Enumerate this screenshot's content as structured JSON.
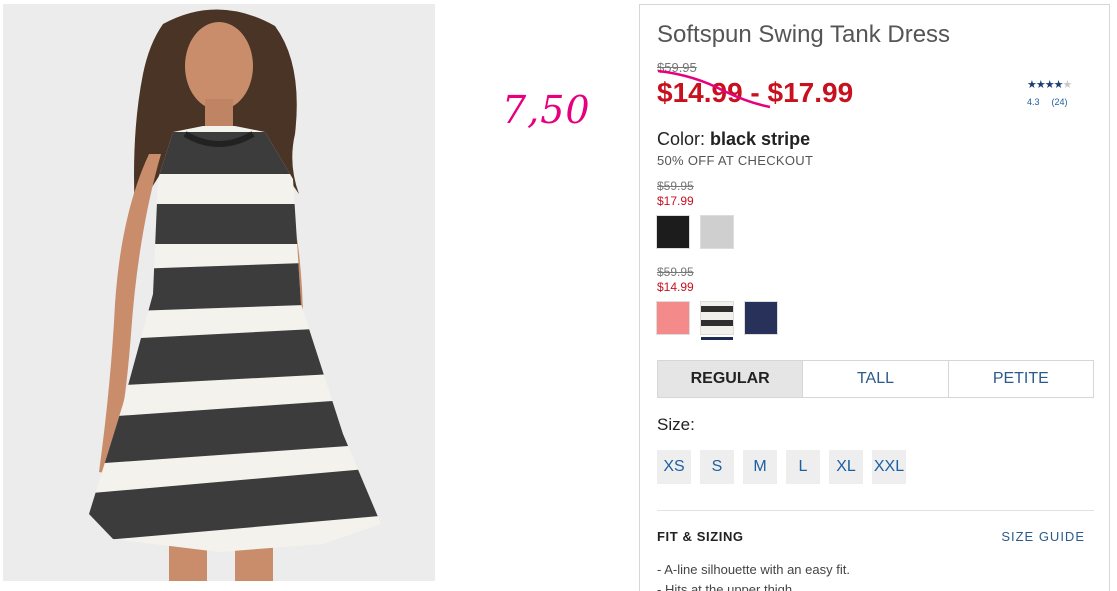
{
  "note": {
    "text": "7,50"
  },
  "product": {
    "title": "Softspun Swing Tank Dress",
    "original_price": "$59.95",
    "sale_price": "$14.99 - $17.99",
    "rating": {
      "stars": "★★★★",
      "half": "★",
      "value": "4.3",
      "count": "(24)"
    },
    "color_label": "Color:",
    "color_value": "black stripe",
    "promo": "50% OFF AT CHECKOUT",
    "price_groups": [
      {
        "was": "$59.95",
        "now": "$17.99",
        "swatches": [
          {
            "name": "black",
            "color": "#1c1c1c"
          },
          {
            "name": "light-heather-grey",
            "color": "#cfcfcf"
          }
        ]
      },
      {
        "was": "$59.95",
        "now": "$14.99",
        "swatches": [
          {
            "name": "coral-pink",
            "color": "#f58a8a"
          },
          {
            "name": "black-stripe",
            "color": "#f1f0ea",
            "selected": true
          },
          {
            "name": "navy",
            "color": "#27315a"
          }
        ]
      }
    ],
    "fit_tabs": [
      {
        "label": "REGULAR",
        "active": true
      },
      {
        "label": "TALL"
      },
      {
        "label": "PETITE"
      }
    ],
    "size_label": "Size:",
    "sizes": [
      "XS",
      "S",
      "M",
      "L",
      "XL",
      "XXL"
    ],
    "fit_heading": "FIT & SIZING",
    "size_guide": "SIZE GUIDE",
    "details": [
      "A-line silhouette with an easy fit.",
      "Hits at the upper thigh."
    ]
  },
  "colors": {
    "sale_red": "#c8101f",
    "link_blue": "#1d5fa3",
    "note_pink": "#e6007e"
  }
}
